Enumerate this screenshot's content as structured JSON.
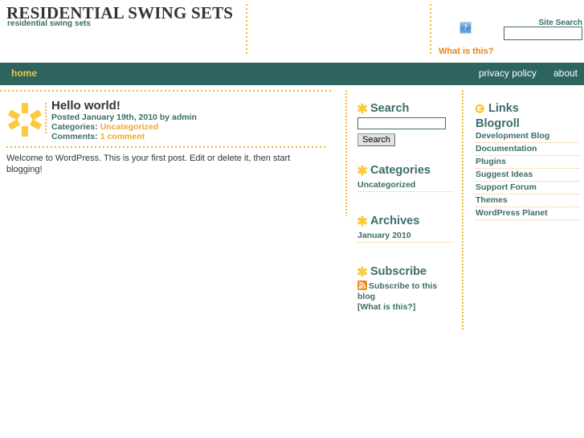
{
  "header": {
    "site_title": "RESIDENTIAL SWING SETS",
    "tagline": "residential swing sets",
    "broken_image_glyph": "?",
    "what_is_this": "What is this?",
    "site_search_label": "Site Search",
    "site_search_value": "",
    "site_search_placeholder": ""
  },
  "nav": {
    "home": "home",
    "privacy_policy": "privacy policy",
    "about": "about"
  },
  "post": {
    "title": "Hello world!",
    "posted": "Posted January 19th, 2010 by admin",
    "categories_label": "Categories:",
    "categories_link": "Uncategorized",
    "comments_label": "Comments:",
    "comments_link": "1 comment",
    "body": "Welcome to WordPress. This is your first post. Edit or delete it, then start blogging!"
  },
  "sidebar_left": {
    "search": {
      "title": "Search",
      "input_value": "",
      "input_placeholder": "",
      "button_label": "Search"
    },
    "categories": {
      "title": "Categories",
      "items": [
        "Uncategorized"
      ]
    },
    "archives": {
      "title": "Archives",
      "items": [
        "January 2010"
      ]
    },
    "subscribe": {
      "title": "Subscribe",
      "feed_link": "Subscribe to this blog",
      "what_is_this": "[What is this?]"
    }
  },
  "sidebar_right": {
    "links": {
      "title": "Links",
      "subtitle": "Blogroll",
      "items": [
        "Development Blog",
        "Documentation",
        "Plugins",
        "Suggest Ideas",
        "Support Forum",
        "Themes",
        "WordPress Planet"
      ]
    }
  },
  "colors": {
    "nav_bg": "#2d6460",
    "accent_gold": "#f2b632",
    "heading_teal": "#3a6d68",
    "orange_link": "#ee8010",
    "star_yellow": "#fbca3e"
  }
}
